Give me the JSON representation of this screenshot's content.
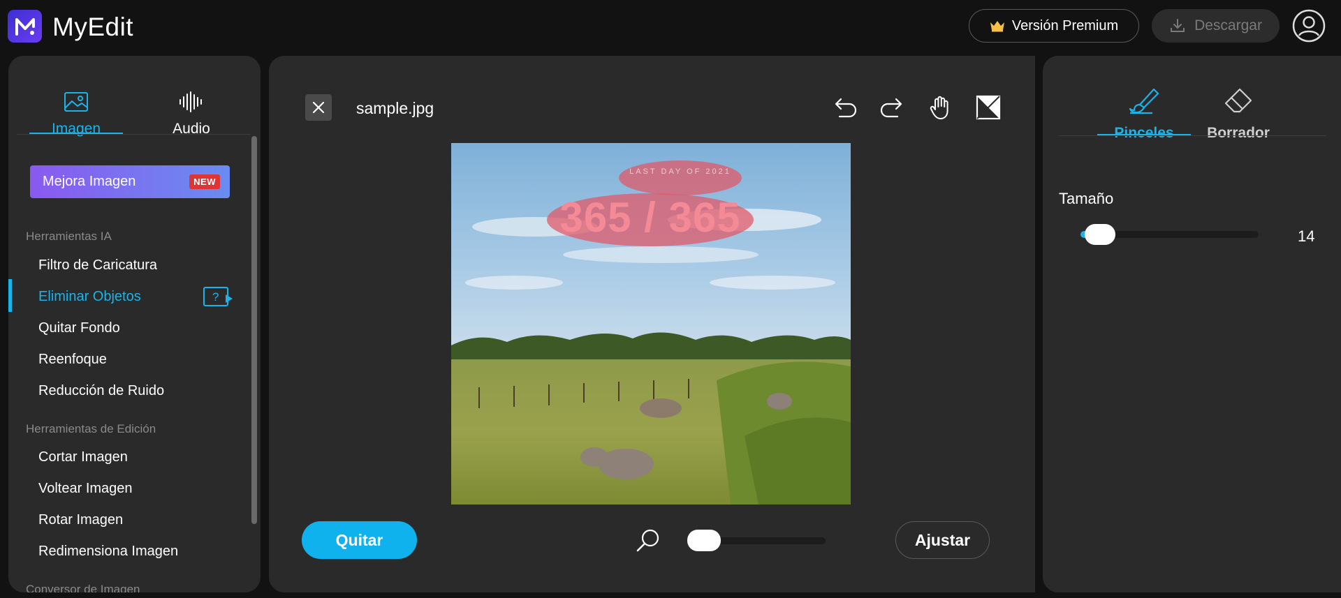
{
  "app": {
    "name": "MyEdit"
  },
  "header": {
    "premium_label": "Versión Premium",
    "download_label": "Descargar"
  },
  "sidebar": {
    "tabs": [
      {
        "label": "Imagen",
        "icon": "image-icon",
        "active": true
      },
      {
        "label": "Audio",
        "icon": "audio-waveform-icon",
        "active": false
      }
    ],
    "promo": {
      "label": "Mejora Imagen",
      "badge": "NEW"
    },
    "sections": [
      {
        "title": "Herramientas IA",
        "items": [
          {
            "label": "Filtro de Caricatura"
          },
          {
            "label": "Eliminar Objetos",
            "active": true
          },
          {
            "label": "Quitar Fondo"
          },
          {
            "label": "Reenfoque"
          },
          {
            "label": "Reducción de Ruido"
          }
        ]
      },
      {
        "title": "Herramientas de Edición",
        "items": [
          {
            "label": "Cortar Imagen"
          },
          {
            "label": "Voltear Imagen"
          },
          {
            "label": "Rotar Imagen"
          },
          {
            "label": "Redimensiona Imagen"
          }
        ]
      },
      {
        "title": "Conversor de Imagen",
        "items": []
      }
    ]
  },
  "editor": {
    "filename": "sample.jpg",
    "tools": [
      "undo-icon",
      "redo-icon",
      "hand-pan-icon",
      "compare-icon"
    ],
    "image_text": {
      "small": "LAST DAY OF 2021",
      "big": "365 / 365"
    },
    "remove_label": "Quitar",
    "fit_label": "Ajustar",
    "zoom_level": 0
  },
  "brush_panel": {
    "tabs": [
      {
        "label": "Pinceles",
        "icon": "brush-icon",
        "active": true
      },
      {
        "label": "Borrador",
        "icon": "eraser-icon",
        "active": false
      }
    ],
    "size_label": "Tamaño",
    "size_value": "14"
  },
  "colors": {
    "accent": "#1ab3ea",
    "panel": "#2a2a2a",
    "background": "#121212",
    "badge": "#e03434"
  }
}
